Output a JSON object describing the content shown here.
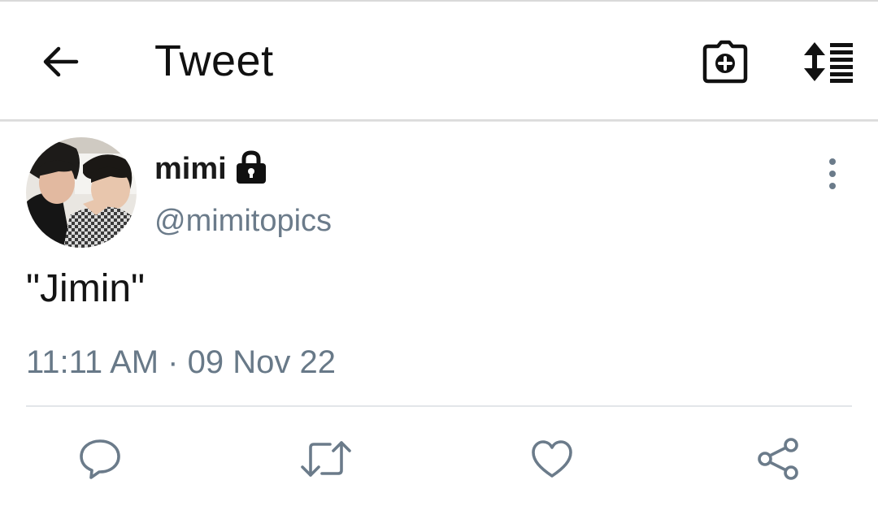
{
  "header": {
    "title": "Tweet",
    "icons": [
      "back-arrow-icon",
      "camera-add-icon",
      "sort-lines-icon"
    ]
  },
  "tweet": {
    "author": {
      "name": "mimi",
      "handle": "@mimitopics",
      "protected": true
    },
    "text": "\"Jimin\"",
    "timestamp": "11:11 AM · 09 Nov 22",
    "actions": [
      "reply-icon",
      "retweet-icon",
      "like-icon",
      "share-icon"
    ]
  },
  "colors": {
    "text_primary": "#141414",
    "text_secondary": "#687988",
    "icon_action": "#6b7b8a",
    "divider": "#e3e6e9"
  }
}
